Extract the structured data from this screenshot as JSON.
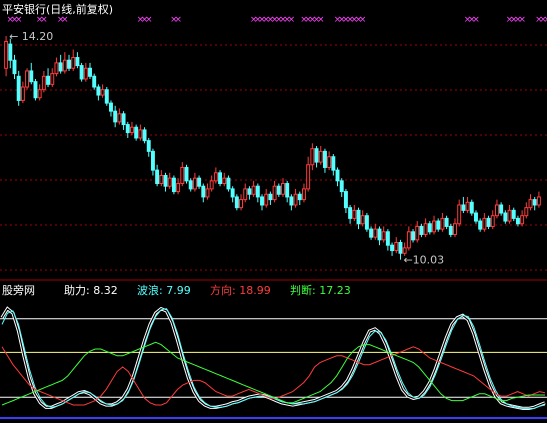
{
  "chart_data": [
    {
      "type": "candlestick",
      "title": "平安银行(日线,前复权)",
      "annotations": [
        {
          "text": "← 14.20",
          "value": 14.2
        },
        {
          "text": "←10.03",
          "value": 10.03
        }
      ],
      "signal_markers": "×",
      "colors": {
        "up": "#ff3c3c",
        "down": "#54ffff",
        "grid": "#a00000",
        "title": "#ffffff",
        "marker": "#ff44ff",
        "annotation": "#c8c8c8"
      },
      "ylim": [
        9.8,
        14.5
      ],
      "marker_idx": [
        1,
        2,
        3,
        8,
        9,
        13,
        14,
        32,
        33,
        34,
        40,
        41,
        59,
        60,
        61,
        62,
        63,
        64,
        65,
        66,
        67,
        68,
        71,
        72,
        73,
        74,
        75,
        79,
        80,
        81,
        82,
        83,
        84,
        85,
        110,
        111,
        112,
        120,
        121,
        122,
        123,
        127,
        128,
        129,
        130,
        131,
        132
      ],
      "candles": [
        [
          13.6,
          14.1,
          14.2,
          13.45
        ],
        [
          14.05,
          13.75,
          14.15,
          13.6
        ],
        [
          13.75,
          13.5,
          13.85,
          13.4
        ],
        [
          13.45,
          13.0,
          13.55,
          12.9
        ],
        [
          13.0,
          13.25,
          13.35,
          12.95
        ],
        [
          13.25,
          13.55,
          13.6,
          13.2
        ],
        [
          13.55,
          13.35,
          13.7,
          13.3
        ],
        [
          13.35,
          13.05,
          13.4,
          13.0
        ],
        [
          13.05,
          13.2,
          13.3,
          13.0
        ],
        [
          13.2,
          13.45,
          13.55,
          13.15
        ],
        [
          13.45,
          13.3,
          13.6,
          13.25
        ],
        [
          13.3,
          13.5,
          13.6,
          13.25
        ],
        [
          13.5,
          13.7,
          13.8,
          13.45
        ],
        [
          13.7,
          13.55,
          13.85,
          13.5
        ],
        [
          13.55,
          13.75,
          13.9,
          13.5
        ],
        [
          13.75,
          13.6,
          13.85,
          13.55
        ],
        [
          13.6,
          13.8,
          13.95,
          13.55
        ],
        [
          13.8,
          13.65,
          13.9,
          13.6
        ],
        [
          13.65,
          13.4,
          13.7,
          13.35
        ],
        [
          13.4,
          13.6,
          13.7,
          13.35
        ],
        [
          13.6,
          13.45,
          13.7,
          13.4
        ],
        [
          13.45,
          13.25,
          13.5,
          13.2
        ],
        [
          13.25,
          13.1,
          13.3,
          13.0
        ],
        [
          13.1,
          13.2,
          13.3,
          13.05
        ],
        [
          13.2,
          12.95,
          13.25,
          12.9
        ],
        [
          12.95,
          12.8,
          13.0,
          12.7
        ],
        [
          12.8,
          12.6,
          12.9,
          12.5
        ],
        [
          12.6,
          12.75,
          12.85,
          12.55
        ],
        [
          12.75,
          12.55,
          12.8,
          12.45
        ],
        [
          12.55,
          12.4,
          12.6,
          12.3
        ],
        [
          12.4,
          12.5,
          12.6,
          12.35
        ],
        [
          12.5,
          12.3,
          12.55,
          12.25
        ],
        [
          12.3,
          12.45,
          12.55,
          12.25
        ],
        [
          12.45,
          12.25,
          12.5,
          12.2
        ],
        [
          12.25,
          12.05,
          12.3,
          11.95
        ],
        [
          12.05,
          11.7,
          12.1,
          11.6
        ],
        [
          11.7,
          11.45,
          11.8,
          11.4
        ],
        [
          11.45,
          11.6,
          11.7,
          11.4
        ],
        [
          11.6,
          11.4,
          11.65,
          11.3
        ],
        [
          11.4,
          11.55,
          11.65,
          11.35
        ],
        [
          11.55,
          11.3,
          11.6,
          11.25
        ],
        [
          11.3,
          11.45,
          11.55,
          11.25
        ],
        [
          11.45,
          11.75,
          11.85,
          11.4
        ],
        [
          11.75,
          11.5,
          11.8,
          11.45
        ],
        [
          11.5,
          11.35,
          11.55,
          11.3
        ],
        [
          11.35,
          11.55,
          11.65,
          11.3
        ],
        [
          11.55,
          11.4,
          11.6,
          11.35
        ],
        [
          11.4,
          11.2,
          11.45,
          11.1
        ],
        [
          11.2,
          11.35,
          11.45,
          11.15
        ],
        [
          11.35,
          11.5,
          11.6,
          11.3
        ],
        [
          11.5,
          11.65,
          11.75,
          11.45
        ],
        [
          11.65,
          11.45,
          11.7,
          11.4
        ],
        [
          11.45,
          11.55,
          11.65,
          11.4
        ],
        [
          11.55,
          11.35,
          11.6,
          11.3
        ],
        [
          11.35,
          11.2,
          11.4,
          11.1
        ],
        [
          11.2,
          11.0,
          11.25,
          10.95
        ],
        [
          11.0,
          11.15,
          11.25,
          10.95
        ],
        [
          11.15,
          11.35,
          11.45,
          11.1
        ],
        [
          11.35,
          11.25,
          11.4,
          11.15
        ],
        [
          11.25,
          11.4,
          11.5,
          11.2
        ],
        [
          11.4,
          11.2,
          11.45,
          11.1
        ],
        [
          11.2,
          11.05,
          11.25,
          10.95
        ],
        [
          11.05,
          11.25,
          11.35,
          11.0
        ],
        [
          11.25,
          11.15,
          11.3,
          11.05
        ],
        [
          11.15,
          11.4,
          11.5,
          11.1
        ],
        [
          11.4,
          11.25,
          11.45,
          11.2
        ],
        [
          11.25,
          11.45,
          11.55,
          11.2
        ],
        [
          11.45,
          11.2,
          11.5,
          11.1
        ],
        [
          11.2,
          11.05,
          11.25,
          10.95
        ],
        [
          11.05,
          11.25,
          11.35,
          11.0
        ],
        [
          11.25,
          11.15,
          11.3,
          11.05
        ],
        [
          11.15,
          11.35,
          11.45,
          11.1
        ],
        [
          11.35,
          11.8,
          11.95,
          11.3
        ],
        [
          11.8,
          12.1,
          12.2,
          11.7
        ],
        [
          12.1,
          11.85,
          12.15,
          11.75
        ],
        [
          11.85,
          12.05,
          12.15,
          11.8
        ],
        [
          12.05,
          11.75,
          12.1,
          11.65
        ],
        [
          11.75,
          11.95,
          12.05,
          11.7
        ],
        [
          11.95,
          11.7,
          12.0,
          11.6
        ],
        [
          11.7,
          11.5,
          11.75,
          11.4
        ],
        [
          11.5,
          11.3,
          11.55,
          11.2
        ],
        [
          11.3,
          11.0,
          11.35,
          10.9
        ],
        [
          11.0,
          10.8,
          11.05,
          10.7
        ],
        [
          10.8,
          10.95,
          11.05,
          10.75
        ],
        [
          10.95,
          10.7,
          11.0,
          10.6
        ],
        [
          10.7,
          10.85,
          10.95,
          10.65
        ],
        [
          10.85,
          10.6,
          10.9,
          10.55
        ],
        [
          10.6,
          10.45,
          10.65,
          10.4
        ],
        [
          10.45,
          10.6,
          10.7,
          10.4
        ],
        [
          10.6,
          10.4,
          10.65,
          10.3
        ],
        [
          10.4,
          10.55,
          10.65,
          10.35
        ],
        [
          10.55,
          10.3,
          10.6,
          10.2
        ],
        [
          10.3,
          10.2,
          10.35,
          10.1
        ],
        [
          10.2,
          10.35,
          10.45,
          10.15
        ],
        [
          10.35,
          10.15,
          10.4,
          10.03
        ],
        [
          10.15,
          10.25,
          10.35,
          10.1
        ],
        [
          10.25,
          10.55,
          10.65,
          10.2
        ],
        [
          10.55,
          10.4,
          10.6,
          10.35
        ],
        [
          10.4,
          10.65,
          10.75,
          10.35
        ],
        [
          10.65,
          10.5,
          10.7,
          10.45
        ],
        [
          10.5,
          10.7,
          10.8,
          10.45
        ],
        [
          10.7,
          10.55,
          10.75,
          10.5
        ],
        [
          10.55,
          10.75,
          10.85,
          10.5
        ],
        [
          10.75,
          10.6,
          10.8,
          10.55
        ],
        [
          10.6,
          10.8,
          10.9,
          10.55
        ],
        [
          10.8,
          10.65,
          10.85,
          10.6
        ],
        [
          10.65,
          10.5,
          10.7,
          10.45
        ],
        [
          10.5,
          10.7,
          10.8,
          10.45
        ],
        [
          10.7,
          11.05,
          11.15,
          10.65
        ],
        [
          11.05,
          10.95,
          11.2,
          10.9
        ],
        [
          10.95,
          11.1,
          11.2,
          10.9
        ],
        [
          11.1,
          10.9,
          11.15,
          10.85
        ],
        [
          10.9,
          10.75,
          10.95,
          10.7
        ],
        [
          10.75,
          10.6,
          10.8,
          10.55
        ],
        [
          10.6,
          10.8,
          10.9,
          10.55
        ],
        [
          10.8,
          10.65,
          10.85,
          10.6
        ],
        [
          10.65,
          10.85,
          10.95,
          10.6
        ],
        [
          10.85,
          11.05,
          11.15,
          10.8
        ],
        [
          11.05,
          10.9,
          11.1,
          10.85
        ],
        [
          10.9,
          10.75,
          10.95,
          10.7
        ],
        [
          10.75,
          10.95,
          11.05,
          10.7
        ],
        [
          10.95,
          10.8,
          11.0,
          10.75
        ],
        [
          10.8,
          10.7,
          10.85,
          10.65
        ],
        [
          10.7,
          10.85,
          10.95,
          10.65
        ],
        [
          10.85,
          11.0,
          11.1,
          10.8
        ],
        [
          11.0,
          11.15,
          11.25,
          10.95
        ],
        [
          11.15,
          11.05,
          11.2,
          10.95
        ],
        [
          11.05,
          11.2,
          11.3,
          11.0
        ]
      ]
    },
    {
      "type": "line",
      "title": "股旁网",
      "legend": [
        {
          "label": "助力:",
          "value": "8.32",
          "color": "#ffffff"
        },
        {
          "label": "波浪:",
          "value": "7.99",
          "color": "#54ffff"
        },
        {
          "label": "方向:",
          "value": "18.99",
          "color": "#ff3c3c"
        },
        {
          "label": "判断:",
          "value": "17.23",
          "color": "#3cff3c"
        }
      ],
      "ylim": [
        0,
        100
      ],
      "ref_lines": [
        {
          "value": 85,
          "color": "#ffffff"
        },
        {
          "value": 55,
          "color": "#ffff80"
        },
        {
          "value": 15,
          "color": "#ffffff"
        }
      ],
      "series": [
        {
          "name": "助力",
          "color": "#ffffff",
          "values": [
            86,
            94,
            90,
            74,
            52,
            32,
            18,
            10,
            6,
            6,
            8,
            10,
            13,
            16,
            19,
            20,
            18,
            14,
            10,
            8,
            8,
            10,
            14,
            22,
            34,
            50,
            66,
            80,
            90,
            94,
            92,
            82,
            66,
            48,
            32,
            20,
            12,
            8,
            6,
            6,
            7,
            8,
            10,
            11,
            13,
            15,
            16,
            17,
            16,
            14,
            12,
            10,
            9,
            8,
            9,
            10,
            11,
            12,
            14,
            16,
            18,
            20,
            24,
            30,
            40,
            52,
            64,
            74,
            76,
            72,
            62,
            48,
            34,
            22,
            16,
            14,
            15,
            20,
            28,
            40,
            54,
            68,
            80,
            86,
            88,
            84,
            72,
            56,
            40,
            26,
            16,
            10,
            8,
            7,
            6,
            5,
            5,
            6,
            8,
            10
          ]
        },
        {
          "name": "波浪",
          "color": "#54ffff",
          "values": [
            80,
            90,
            92,
            80,
            60,
            40,
            24,
            14,
            8,
            6,
            7,
            9,
            12,
            15,
            18,
            20,
            19,
            16,
            12,
            9,
            8,
            9,
            12,
            19,
            30,
            45,
            61,
            76,
            87,
            93,
            94,
            86,
            72,
            54,
            38,
            24,
            15,
            10,
            7,
            6,
            6,
            7,
            9,
            10,
            12,
            14,
            15,
            16,
            16,
            15,
            13,
            11,
            10,
            9,
            9,
            9,
            10,
            11,
            13,
            15,
            17,
            19,
            22,
            27,
            35,
            46,
            58,
            69,
            74,
            73,
            66,
            54,
            40,
            28,
            19,
            15,
            14,
            17,
            24,
            35,
            48,
            62,
            75,
            84,
            88,
            87,
            78,
            63,
            47,
            32,
            21,
            13,
            9,
            7,
            6,
            5,
            5,
            5,
            7,
            8
          ]
        },
        {
          "name": "方向",
          "color": "#ff3c3c",
          "values": [
            60,
            52,
            44,
            38,
            32,
            26,
            22,
            20,
            18,
            16,
            14,
            12,
            10,
            8,
            8,
            8,
            10,
            12,
            16,
            22,
            30,
            38,
            42,
            38,
            30,
            22,
            14,
            10,
            8,
            8,
            10,
            16,
            22,
            26,
            28,
            30,
            30,
            28,
            24,
            20,
            18,
            16,
            16,
            18,
            20,
            22,
            20,
            18,
            16,
            14,
            14,
            16,
            18,
            20,
            24,
            28,
            34,
            42,
            46,
            48,
            50,
            52,
            52,
            50,
            48,
            46,
            44,
            44,
            46,
            48,
            50,
            52,
            54,
            56,
            58,
            60,
            58,
            54,
            50,
            48,
            46,
            44,
            42,
            40,
            38,
            36,
            34,
            30,
            26,
            22,
            18,
            16,
            16,
            18,
            20,
            18,
            16,
            18,
            20,
            19
          ]
        },
        {
          "name": "判断",
          "color": "#3cff3c",
          "values": [
            8,
            10,
            12,
            14,
            16,
            18,
            20,
            22,
            24,
            26,
            28,
            30,
            34,
            40,
            46,
            52,
            56,
            58,
            58,
            56,
            54,
            52,
            52,
            54,
            56,
            58,
            60,
            62,
            64,
            62,
            58,
            54,
            50,
            48,
            46,
            44,
            42,
            40,
            38,
            36,
            34,
            32,
            30,
            28,
            26,
            24,
            22,
            20,
            18,
            16,
            14,
            12,
            10,
            10,
            12,
            14,
            16,
            18,
            20,
            24,
            28,
            34,
            42,
            50,
            56,
            60,
            62,
            62,
            60,
            58,
            56,
            54,
            52,
            50,
            48,
            46,
            42,
            36,
            30,
            24,
            18,
            14,
            12,
            12,
            12,
            14,
            16,
            18,
            18,
            16,
            14,
            12,
            12,
            14,
            15,
            16,
            17,
            17,
            17,
            17
          ]
        }
      ]
    }
  ]
}
